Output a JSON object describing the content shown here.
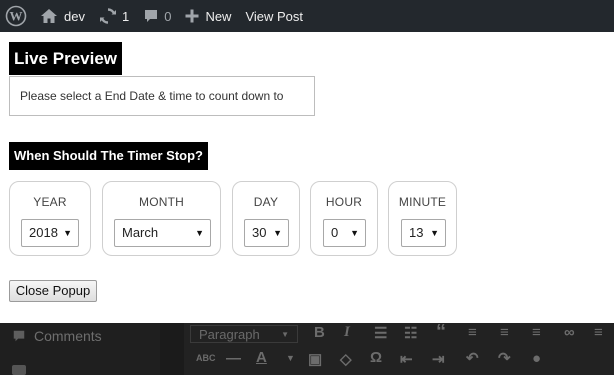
{
  "adminbar": {
    "site_name": "dev",
    "updates_count": "1",
    "comments_count": "0",
    "new_label": "New",
    "view_post_label": "View Post"
  },
  "editor_bg": {
    "comments_label": "Comments",
    "block_format": "Paragraph"
  },
  "popup": {
    "preview_title": "Live Preview",
    "preview_message": "Please select a End Date & time to count down to",
    "timer_title": "When Should The Timer Stop?",
    "fields": {
      "year": {
        "caption": "YEAR",
        "value": "2018"
      },
      "month": {
        "caption": "MONTH",
        "value": "March"
      },
      "day": {
        "caption": "DAY",
        "value": "30"
      },
      "hour": {
        "caption": "HOUR",
        "value": "0"
      },
      "minute": {
        "caption": "MINUTE",
        "value": "13"
      }
    },
    "close_label": "Close Popup"
  },
  "icons": [
    "wordpress-icon",
    "home-icon",
    "updates-icon",
    "comment-icon",
    "plus-icon"
  ]
}
